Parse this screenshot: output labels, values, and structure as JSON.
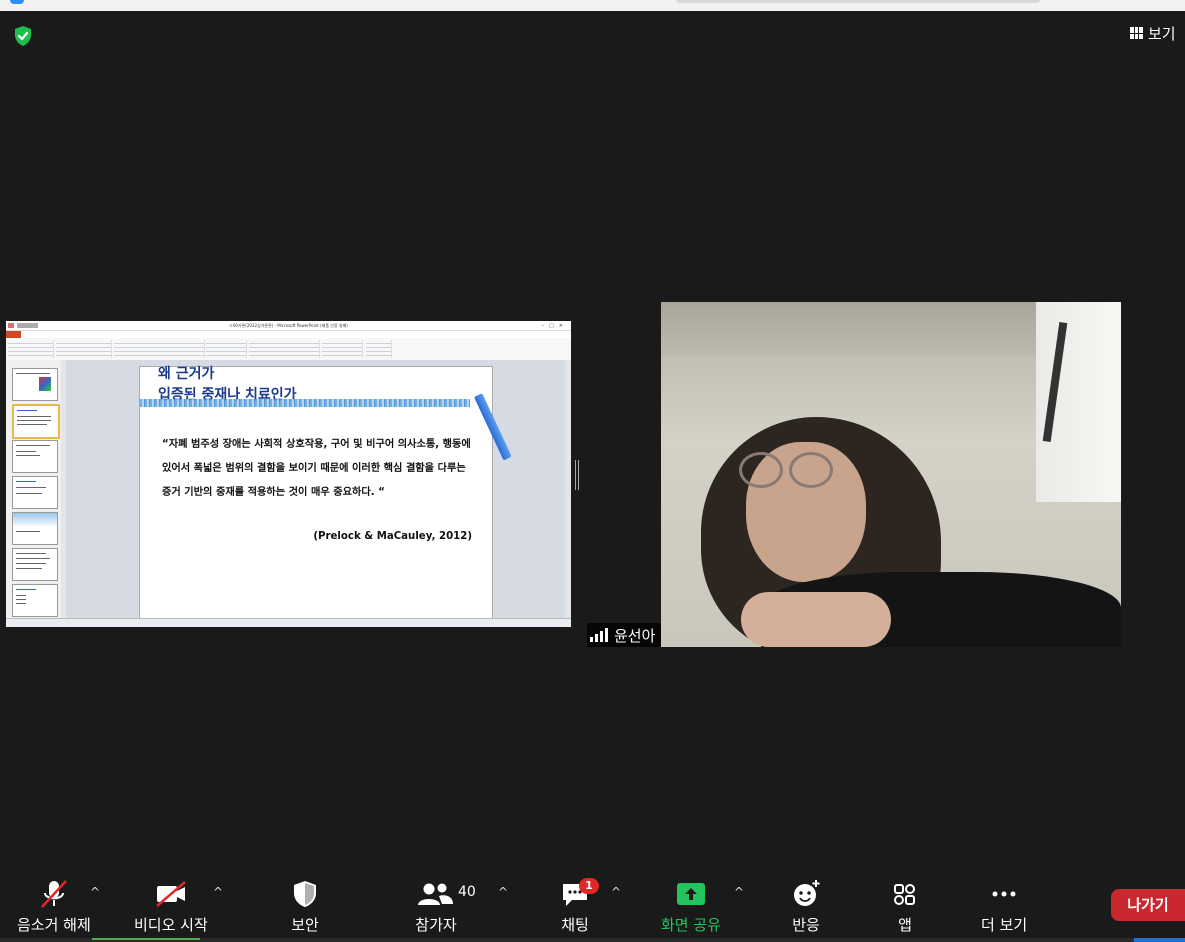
{
  "header": {
    "view_label": "보기",
    "security_icon": "shield-check-icon",
    "security_color": "#1fbf4f"
  },
  "shared_screen": {
    "window_title": "ㅁ00가론(2022심가룬론) - Microsoft PowerPoint (제품 인증 실패)",
    "slide": {
      "title_line1": "왜 근거가",
      "title_line2": "입증된 중재나 치료인가",
      "quote": "“자폐 범주성 장애는 사회적 상호작용, 구어 및 비구어 의사소통, 행동에 있어서 폭넓은 범위의 결함을 보이기 때문에 이러한 핵심 결함을 다루는 증거 기반의 중재를 적용하는 것이 매우 중요하다. “",
      "citation": "(Prelock & MaCauley, 2012)"
    }
  },
  "participant": {
    "name": "윤선아"
  },
  "toolbar": {
    "mute_label": "음소거 해제",
    "video_label": "비디오 시작",
    "security_label": "보안",
    "participants_label": "참가자",
    "participants_count": "40",
    "chat_label": "채팅",
    "chat_badge": "1",
    "share_label": "화면 공유",
    "share_color": "#23c45e",
    "reactions_label": "반응",
    "apps_label": "앱",
    "more_label": "더 보기",
    "leave_label": "나가기",
    "leave_color": "#c8282e"
  }
}
